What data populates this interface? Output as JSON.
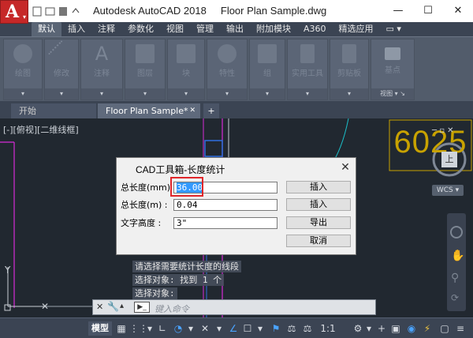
{
  "window": {
    "title": "Autodesk AutoCAD 2018     Floor Plan Sample.dwg",
    "minimize": "—",
    "restore": "☐",
    "close": "✕"
  },
  "ribbon": {
    "tabs": [
      "默认",
      "插入",
      "注释",
      "参数化",
      "视图",
      "管理",
      "输出",
      "附加模块",
      "A360",
      "精选应用",
      "▭ ▾"
    ],
    "panels": [
      {
        "label": "绘图",
        "foot": "▾"
      },
      {
        "label": "修改",
        "foot": "▾"
      },
      {
        "label": "注释",
        "foot": "▾"
      },
      {
        "label": "图层",
        "foot": "▾"
      },
      {
        "label": "块",
        "foot": "▾"
      },
      {
        "label": "特性",
        "foot": "▾"
      },
      {
        "label": "组",
        "foot": "▾"
      },
      {
        "label": "实用工具",
        "foot": "▾"
      },
      {
        "label": "剪贴板",
        "foot": "▾"
      },
      {
        "label": "基点",
        "foot": "视图 ▾ ↘"
      }
    ]
  },
  "doc_tabs": {
    "start": "开始",
    "active": "Floor Plan Sample*",
    "active_close": "✕",
    "add": "+"
  },
  "canvas": {
    "view_label": "[-][俯视][二维线框]",
    "text_value": "6025",
    "viewcube_label": "上",
    "wcs_label": "WCS ▾"
  },
  "dialog": {
    "title": "CAD工具箱-长度统计",
    "close": "✕",
    "rows": [
      {
        "label": "总长度(mm)  :",
        "value": "36.00",
        "button": "插入"
      },
      {
        "label": "总长度(m)   :",
        "value": "0.04",
        "button": "插入"
      },
      {
        "label": "文字高度    :",
        "value": "3\"",
        "button": "导出"
      }
    ],
    "cancel": "取消"
  },
  "command": {
    "history": [
      "请选择需要统计长度的线段",
      "选择对象: 找到 1 个",
      "选择对象:"
    ],
    "placeholder": "键入命令"
  },
  "statusbar": {
    "model": "模型",
    "scale": "1:1 ▾"
  }
}
